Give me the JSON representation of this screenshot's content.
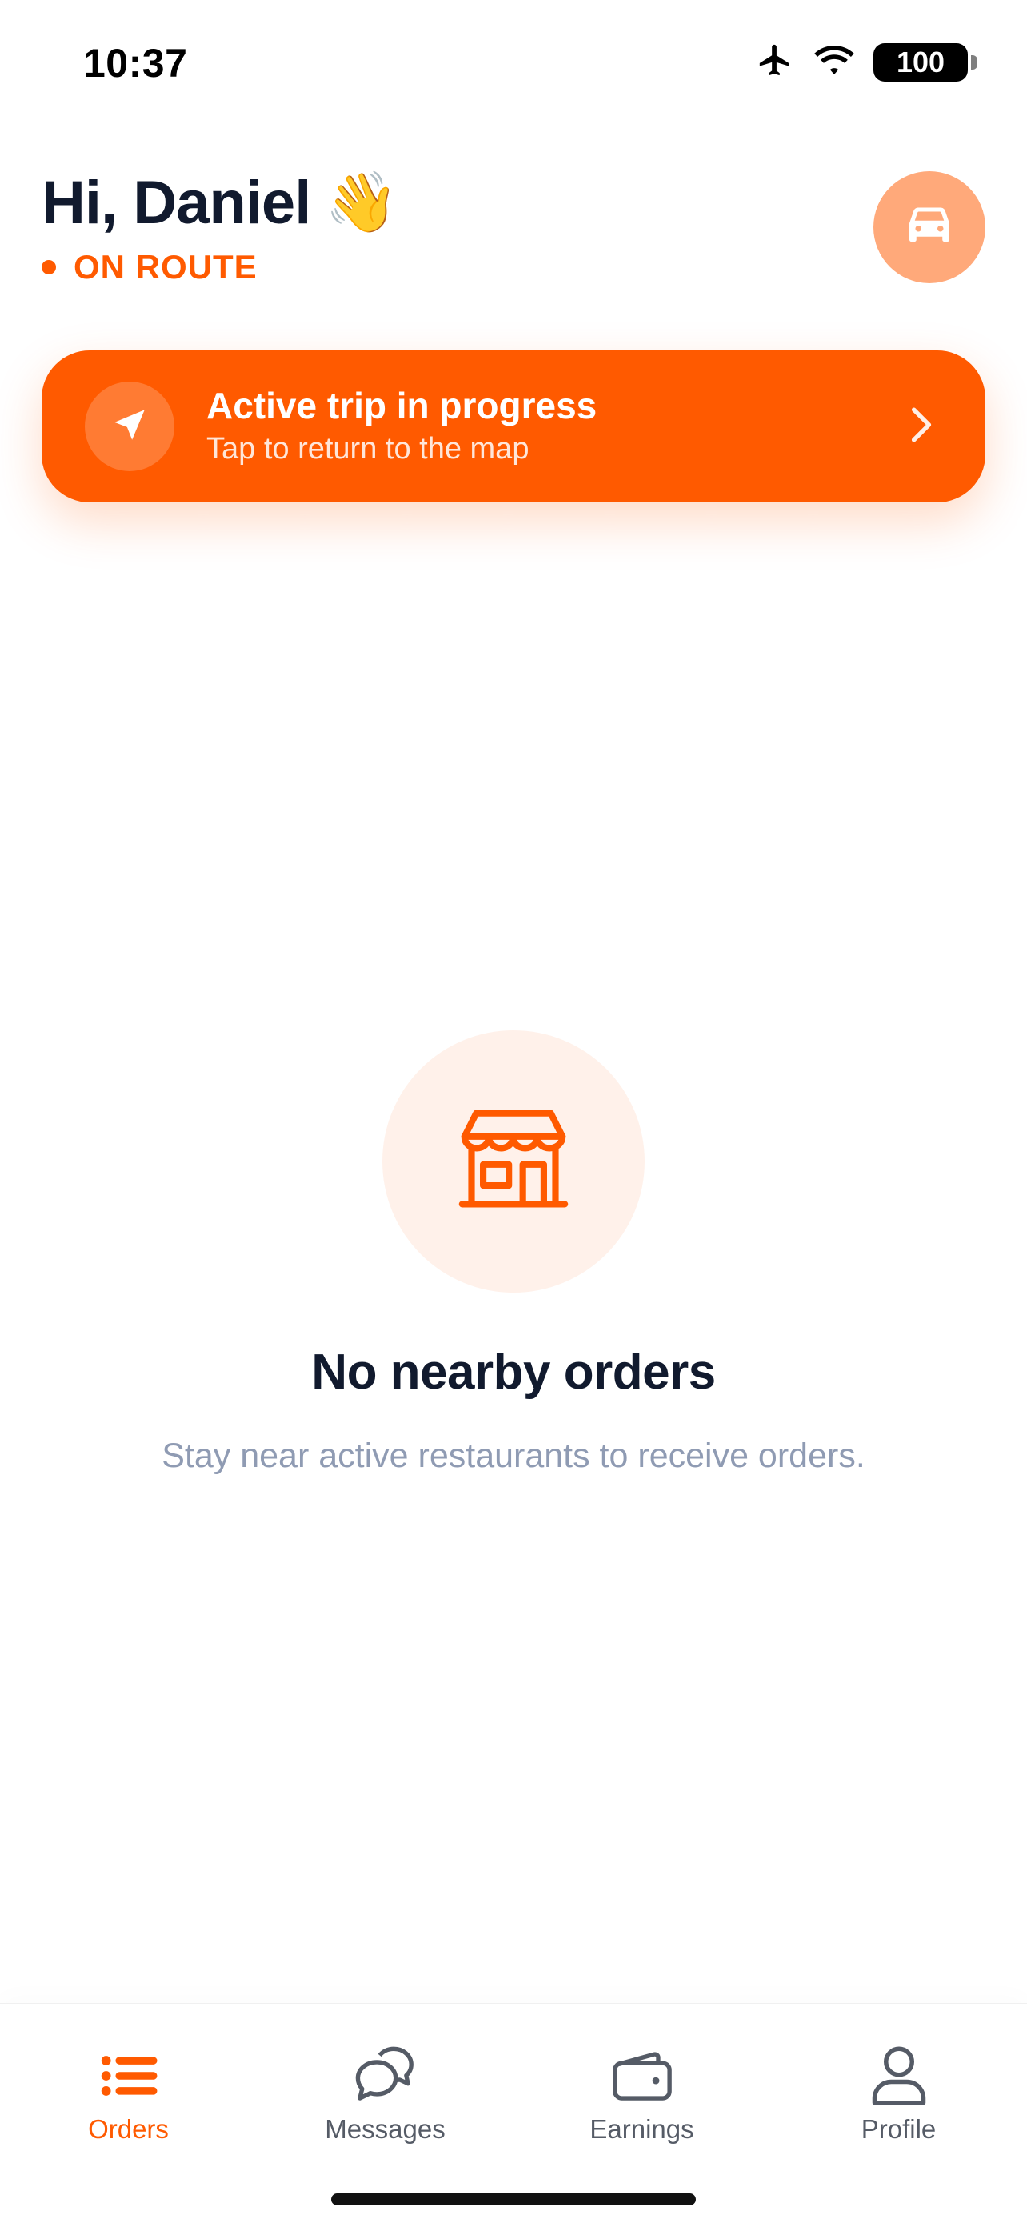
{
  "status_bar": {
    "time": "10:37",
    "battery": "100",
    "icons": [
      "airplane-icon",
      "wifi-icon",
      "battery-icon"
    ]
  },
  "header": {
    "greeting": "Hi, Daniel",
    "wave_emoji": "👋",
    "status": "ON ROUTE",
    "vehicle_icon": "car-icon"
  },
  "trip_banner": {
    "title": "Active trip in progress",
    "subtitle": "Tap to return to the map",
    "icon": "navigation-arrow-icon"
  },
  "empty_state": {
    "icon": "storefront-icon",
    "title": "No nearby orders",
    "subtitle": "Stay near active restaurants to receive orders."
  },
  "tabs": [
    {
      "label": "Orders",
      "icon": "list-icon",
      "active": true
    },
    {
      "label": "Messages",
      "icon": "chat-bubbles-icon",
      "active": false
    },
    {
      "label": "Earnings",
      "icon": "wallet-icon",
      "active": false
    },
    {
      "label": "Profile",
      "icon": "user-icon",
      "active": false
    }
  ],
  "colors": {
    "accent": "#ff5a00",
    "accent_light": "#ffa97a",
    "empty_circle": "#fff1ea",
    "text_dark": "#111a2e",
    "text_muted": "#8f9bb3",
    "tab_inactive": "#555b66"
  }
}
